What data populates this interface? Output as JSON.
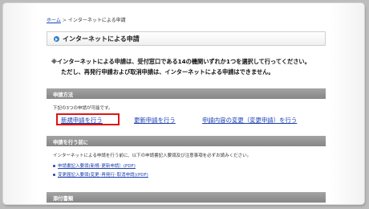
{
  "breadcrumb": {
    "home": "ホーム",
    "separator": ">",
    "current": "インターネットによる申請"
  },
  "page_title": "インターネットによる申請",
  "notice": {
    "line1": "※インターネットによる申請は、受付窓口である14の機関いずれか1つを選択して行ってください。",
    "line2": "ただし、再発行申請および取消申請は、インターネットによる申請はできません。"
  },
  "application_methods": {
    "heading": "申請方法",
    "intro": "下記の3つの申請が可能です。",
    "links": {
      "new": "新規申請を行う",
      "renewal": "更新申請を行う",
      "change": "申請内容の変更（変更申請）を行う"
    }
  },
  "before_apply": {
    "heading": "申請を行う前に",
    "intro": "インターネットによる申請を行う前に、以下の申請書記入要領及び注意事項を必ずお読みください。",
    "links": {
      "guide_new_renewal": "申請書記入要領(新規･更新申請）(PDF)",
      "guide_change_reissue": "変更届記入要領(変更･再発行･取消申請)(PDF)"
    }
  },
  "attachments": {
    "heading": "添付書類"
  },
  "colors": {
    "section_bar": "#8f8f8f",
    "link": "#1a3fb0",
    "highlight": "#e01414",
    "title_icon": "#2f7fc8"
  }
}
